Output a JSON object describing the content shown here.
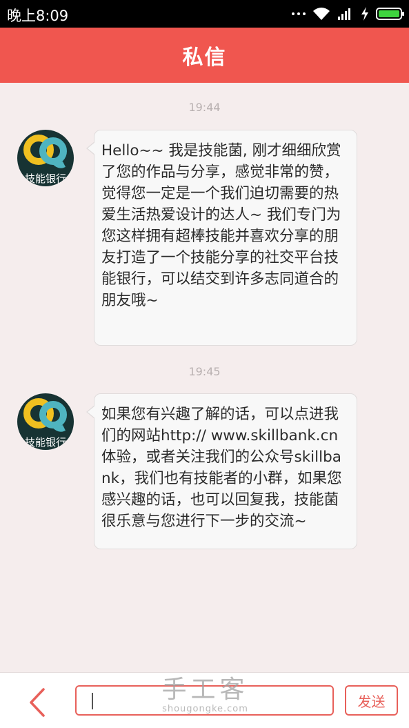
{
  "status_bar": {
    "time": "晚上8:09"
  },
  "header": {
    "title": "私信"
  },
  "messages": [
    {
      "timestamp": "19:44",
      "avatar_text": "技能银行",
      "text": "Hello~~ 我是技能菌, 刚才细细欣赏了您的作品与分享，感觉非常的赞，觉得您一定是一个我们迫切需要的热爱生活热爱设计的达人~ 我们专门为您这样拥有超棒技能并喜欢分享的朋友打造了一个技能分享的社交平台技能银行，可以结交到许多志同道合的朋友哦~"
    },
    {
      "timestamp": "19:45",
      "avatar_text": "技能银行",
      "text": "如果您有兴趣了解的话，可以点进我们的网站http:// www.skillbank.cn体验，或者关注我们的公众号skillbank，我们也有技能者的小群，如果您感兴趣的话，也可以回复我，技能菌很乐意与您进行下一步的交流~"
    }
  ],
  "input_bar": {
    "send_label": "发送",
    "input_value": ""
  },
  "watermark": {
    "title": "手工客",
    "domain": "shougongke.com"
  },
  "colors": {
    "accent": "#f0564f",
    "background": "#f5eded"
  }
}
